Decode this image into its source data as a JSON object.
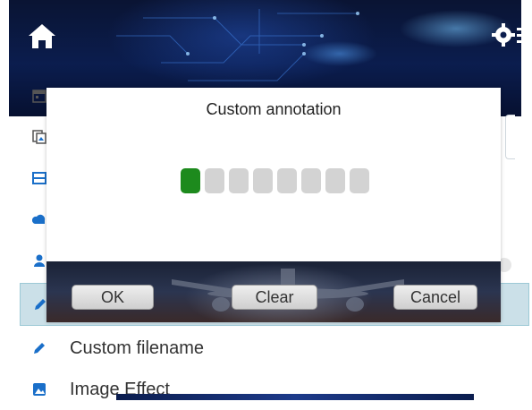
{
  "header": {
    "home_icon": "home-icon",
    "settings_icon": "settings-icon"
  },
  "list": {
    "items": [
      {
        "icon": "calendar-icon",
        "label": ""
      },
      {
        "icon": "image-copy-icon",
        "label": ""
      },
      {
        "icon": "layout-icon",
        "label": ""
      },
      {
        "icon": "cloud-icon",
        "label": ""
      },
      {
        "icon": "user-icon",
        "label": ""
      },
      {
        "icon": "pencil-icon",
        "label": ""
      },
      {
        "icon": "pencil-icon",
        "label": "Custom filename"
      },
      {
        "icon": "image-effect-icon",
        "label": "Image Effect"
      }
    ]
  },
  "dialog": {
    "title": "Custom annotation",
    "slots_total": 8,
    "slots_active_index": 0,
    "ok_label": "OK",
    "clear_label": "Clear",
    "cancel_label": "Cancel"
  },
  "colors": {
    "accent_green": "#1d8a1d",
    "slot_gray": "#d3d3d3",
    "icon_blue": "#1a6fc9",
    "selected_row": "#cbe0e8"
  }
}
